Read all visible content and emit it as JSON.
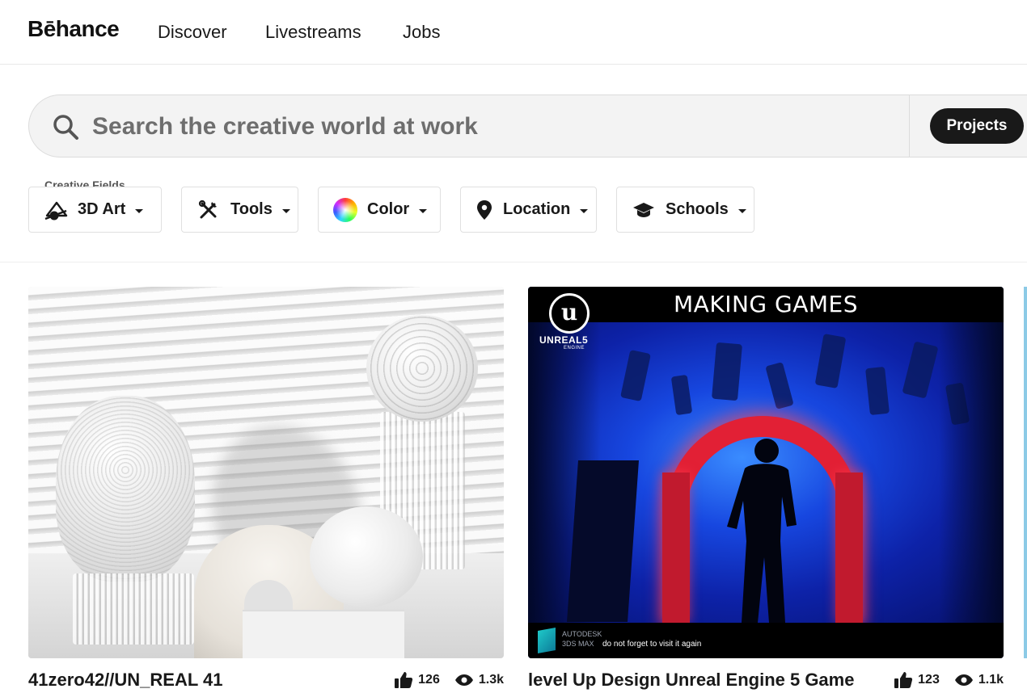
{
  "header": {
    "logo": "Bēhance",
    "nav": [
      "Discover",
      "Livestreams",
      "Jobs"
    ]
  },
  "search": {
    "placeholder": "Search the creative world at work",
    "scope_button": "Projects"
  },
  "filters": {
    "caption": "Creative Fields",
    "items": [
      {
        "label": "3D Art",
        "icon": "3d-art-icon"
      },
      {
        "label": "Tools",
        "icon": "tools-icon"
      },
      {
        "label": "Color",
        "icon": "color-wheel-icon"
      },
      {
        "label": "Location",
        "icon": "location-pin-icon"
      },
      {
        "label": "Schools",
        "icon": "graduation-cap-icon"
      }
    ]
  },
  "projects": [
    {
      "title": "41zero42//UN_REAL 41",
      "likes": "126",
      "views": "1.3k"
    },
    {
      "title": "level Up Design Unreal Engine 5 Game",
      "likes": "123",
      "views": "1.1k",
      "thumb": {
        "heading": "MAKING GAMES",
        "logo_mark": "u",
        "engine_name": "UNREAL5",
        "engine_sub": "ENGINE",
        "brand_line1": "AUTODESK",
        "brand_line2": "3DS MAX",
        "footer_note": "do not forget to visit it again"
      }
    }
  ],
  "colors": {
    "text": "#191919",
    "button_bg": "#191919",
    "search_bg": "#f3f3f3",
    "arch_red": "#e22035",
    "scene_blue": "#1747e0"
  }
}
